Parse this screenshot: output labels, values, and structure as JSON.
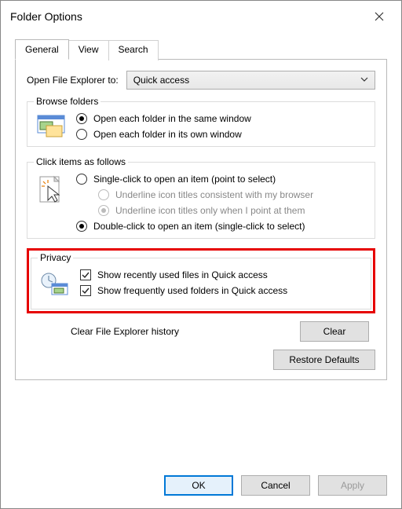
{
  "window": {
    "title": "Folder Options"
  },
  "tabs": {
    "general": "General",
    "view": "View",
    "search": "Search"
  },
  "openExplorer": {
    "label": "Open File Explorer to:",
    "value": "Quick access"
  },
  "browseFolders": {
    "legend": "Browse folders",
    "opt_same": "Open each folder in the same window",
    "opt_own": "Open each folder in its own window"
  },
  "clickItems": {
    "legend": "Click items as follows",
    "single": "Single-click to open an item (point to select)",
    "underline_browser": "Underline icon titles consistent with my browser",
    "underline_point": "Underline icon titles only when I point at them",
    "double": "Double-click to open an item (single-click to select)"
  },
  "privacy": {
    "legend": "Privacy",
    "recent_files": "Show recently used files in Quick access",
    "frequent_folders": "Show frequently used folders in Quick access",
    "clear_label": "Clear File Explorer history",
    "clear_btn": "Clear"
  },
  "buttons": {
    "restore": "Restore Defaults",
    "ok": "OK",
    "cancel": "Cancel",
    "apply": "Apply"
  }
}
